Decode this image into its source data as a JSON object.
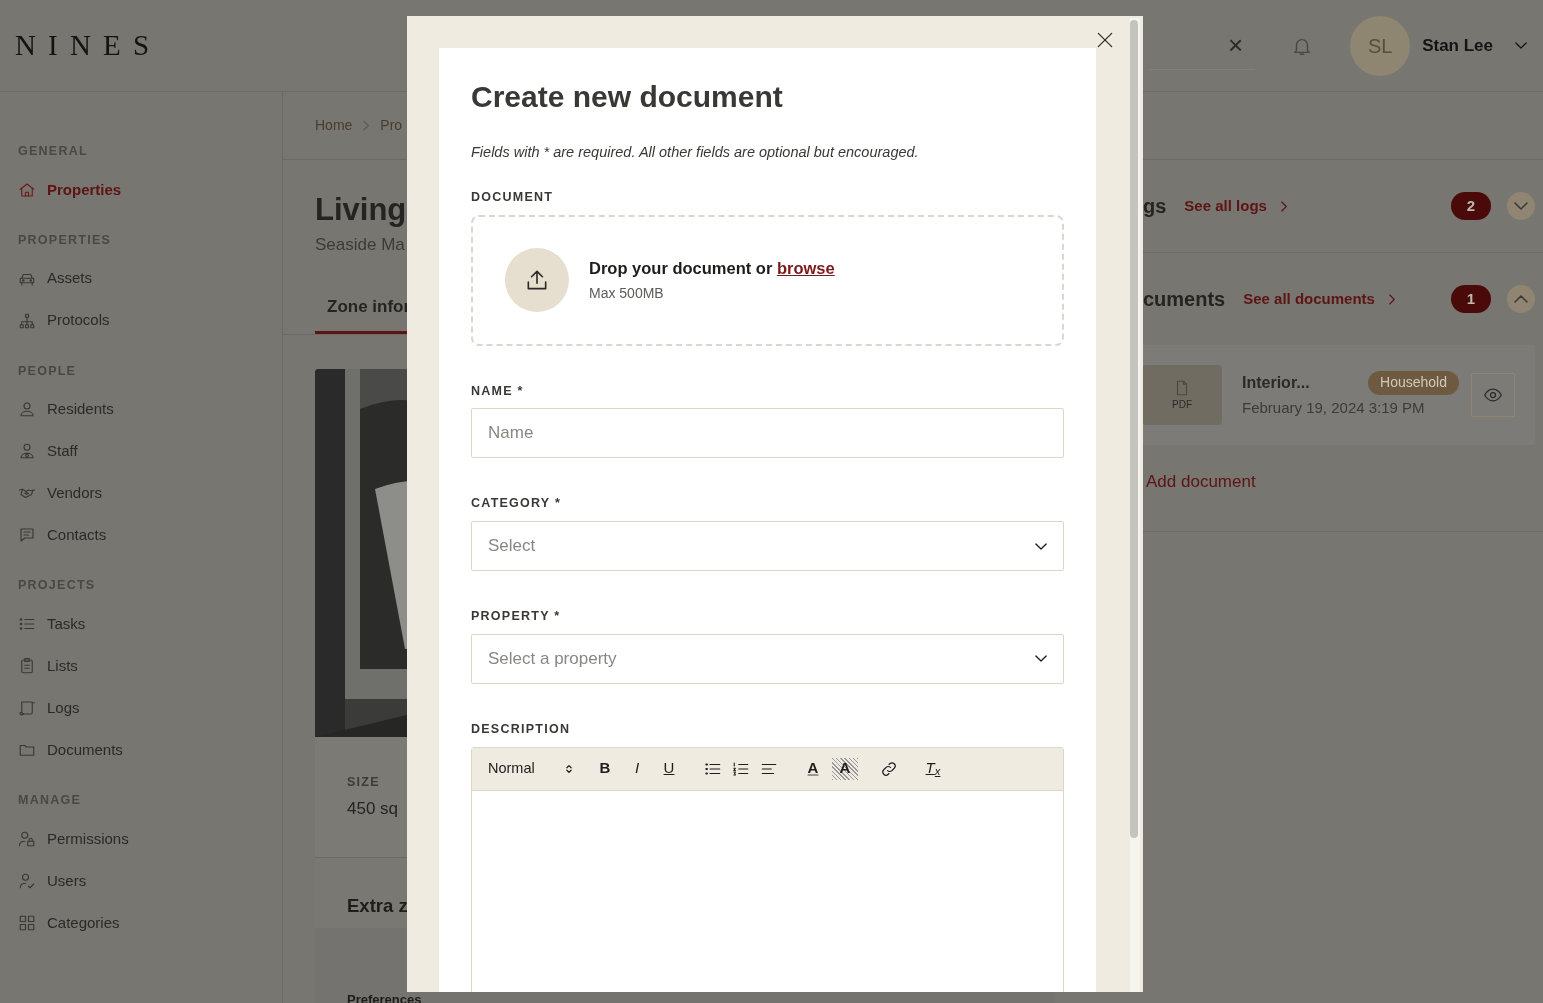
{
  "app": {
    "logo": "NINES"
  },
  "header": {
    "clear_search": "×",
    "user": {
      "initials": "SL",
      "name": "Stan Lee"
    }
  },
  "sidebar": {
    "sections": [
      {
        "title": "GENERAL",
        "items": [
          {
            "label": "Properties",
            "selected": true
          }
        ]
      },
      {
        "title": "PROPERTIES",
        "items": [
          {
            "label": "Assets",
            "selected": false
          },
          {
            "label": "Protocols",
            "selected": false
          }
        ]
      },
      {
        "title": "PEOPLE",
        "items": [
          {
            "label": "Residents",
            "selected": false
          },
          {
            "label": "Staff",
            "selected": false
          },
          {
            "label": "Vendors",
            "selected": false
          },
          {
            "label": "Contacts",
            "selected": false
          }
        ]
      },
      {
        "title": "PROJECTS",
        "items": [
          {
            "label": "Tasks",
            "selected": false
          },
          {
            "label": "Lists",
            "selected": false
          },
          {
            "label": "Logs",
            "selected": false
          },
          {
            "label": "Documents",
            "selected": false
          }
        ]
      },
      {
        "title": "MANAGE",
        "items": [
          {
            "label": "Permissions",
            "selected": false
          },
          {
            "label": "Users",
            "selected": false
          },
          {
            "label": "Categories",
            "selected": false
          }
        ]
      }
    ]
  },
  "breadcrumb": [
    "Home",
    "Pro"
  ],
  "page": {
    "title": "Living",
    "subtitle": "Seaside Ma",
    "tabs": [
      {
        "label": "Zone infor",
        "selected": true
      }
    ],
    "size_label": "SIZE",
    "size_value": "450 sq",
    "extra_title": "Extra z",
    "preferences": {
      "label": "Preferences"
    }
  },
  "panels": [
    {
      "title": "gs",
      "link": "See all logs",
      "count": "2",
      "expanded": false
    },
    {
      "title": "cuments",
      "link": "See all documents",
      "count": "1",
      "expanded": true,
      "items": [
        {
          "file_type": "PDF",
          "name": "Interior...",
          "tag": "Household",
          "date": "February 19, 2024 3:19 PM"
        }
      ],
      "add": "Add document"
    }
  ],
  "modal": {
    "title": "Create new document",
    "note": "Fields with * are required. All other fields are optional but encouraged.",
    "document_label": "DOCUMENT",
    "dropzone": {
      "text": "Drop your document or",
      "link": "browse",
      "hint": "Max 500MB"
    },
    "fields": [
      {
        "label": "NAME *",
        "kind": "text",
        "placeholder": "Name"
      },
      {
        "label": "CATEGORY *",
        "kind": "select",
        "placeholder": "Select"
      },
      {
        "label": "PROPERTY *",
        "kind": "select",
        "placeholder": "Select a property"
      }
    ],
    "description": {
      "label": "DESCRIPTION",
      "format": "Normal",
      "tool_groups": [
        [
          {
            "kind": "bold",
            "text": "B"
          },
          {
            "kind": "italic",
            "text": "I"
          },
          {
            "kind": "underline",
            "text": "U"
          }
        ],
        [
          {
            "kind": "bullet-list"
          },
          {
            "kind": "ordered-list"
          },
          {
            "kind": "align"
          }
        ],
        [
          {
            "kind": "text-color",
            "text": "A"
          },
          {
            "kind": "highlight",
            "text": "A"
          }
        ],
        [
          {
            "kind": "link"
          }
        ],
        [
          {
            "kind": "clear-format",
            "text": "T$_{x}$"
          }
        ]
      ]
    }
  }
}
